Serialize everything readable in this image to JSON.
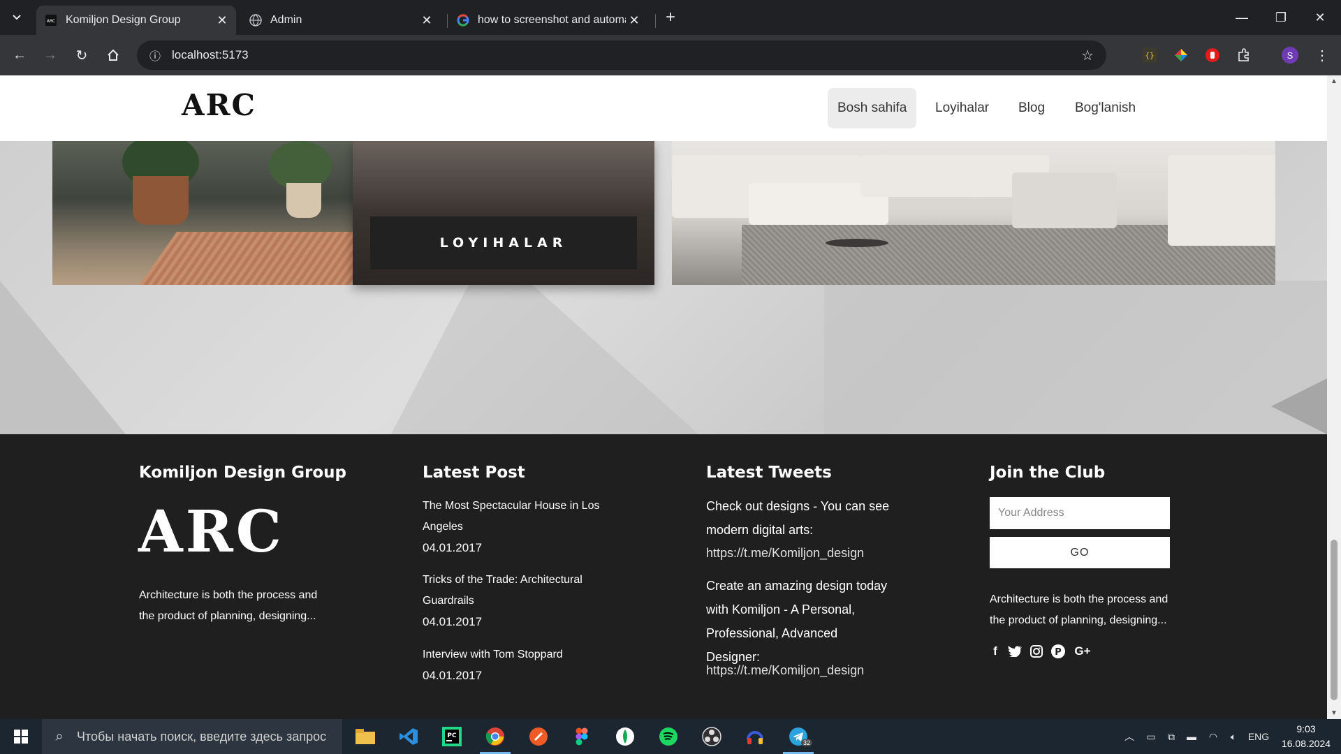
{
  "browser": {
    "tabs": [
      {
        "title": "Komiljon Design Group",
        "active": true,
        "favicon": "arc-logo-icon"
      },
      {
        "title": "Admin",
        "active": false,
        "favicon": "globe-icon"
      },
      {
        "title": "how to screenshot and automat",
        "active": false,
        "favicon": "google-icon"
      }
    ],
    "new_tab": "+",
    "url": "localhost:5173",
    "profile_initial": "S"
  },
  "site": {
    "logo": "ARC",
    "nav": [
      {
        "label": "Bosh sahifa",
        "active": true
      },
      {
        "label": "Loyihalar",
        "active": false
      },
      {
        "label": "Blog",
        "active": false
      },
      {
        "label": "Bog'lanish",
        "active": false
      }
    ],
    "projects_button": "LOYIHALAR"
  },
  "footer": {
    "about": {
      "heading": "Komiljon Design Group",
      "logo": "ARC",
      "text": "Architecture is both the process and the product of planning, designing..."
    },
    "latest_post": {
      "heading": "Latest Post",
      "posts": [
        {
          "title": "The Most Spectacular House in Los Angeles",
          "date": "04.01.2017"
        },
        {
          "title": "Tricks of the Trade: Architectural Guardrails",
          "date": "04.01.2017"
        },
        {
          "title": "Interview with Tom Stoppard",
          "date": "04.01.2017"
        }
      ]
    },
    "latest_tweets": {
      "heading": "Latest Tweets",
      "tweets": [
        {
          "text": "Check out designs - You can see modern digital arts:",
          "link": "https://t.me/Komiljon_design"
        },
        {
          "text": "Create an amazing design today with Komiljon - A Personal, Professional, Advanced Designer:",
          "link": "https://t.me/Komiljon_design"
        }
      ]
    },
    "club": {
      "heading": "Join the Club",
      "email_placeholder": "Your Address",
      "button": "GO",
      "text": "Architecture is both the process and the product of planning, designing...",
      "social": [
        "facebook-icon",
        "twitter-icon",
        "instagram-icon",
        "pinterest-icon",
        "google-plus-icon"
      ]
    }
  },
  "taskbar": {
    "search_placeholder": "Чтобы начать поиск, введите здесь запрос",
    "language": "ENG",
    "time": "9:03",
    "date": "16.08.2024",
    "telegram_badge": "32"
  }
}
